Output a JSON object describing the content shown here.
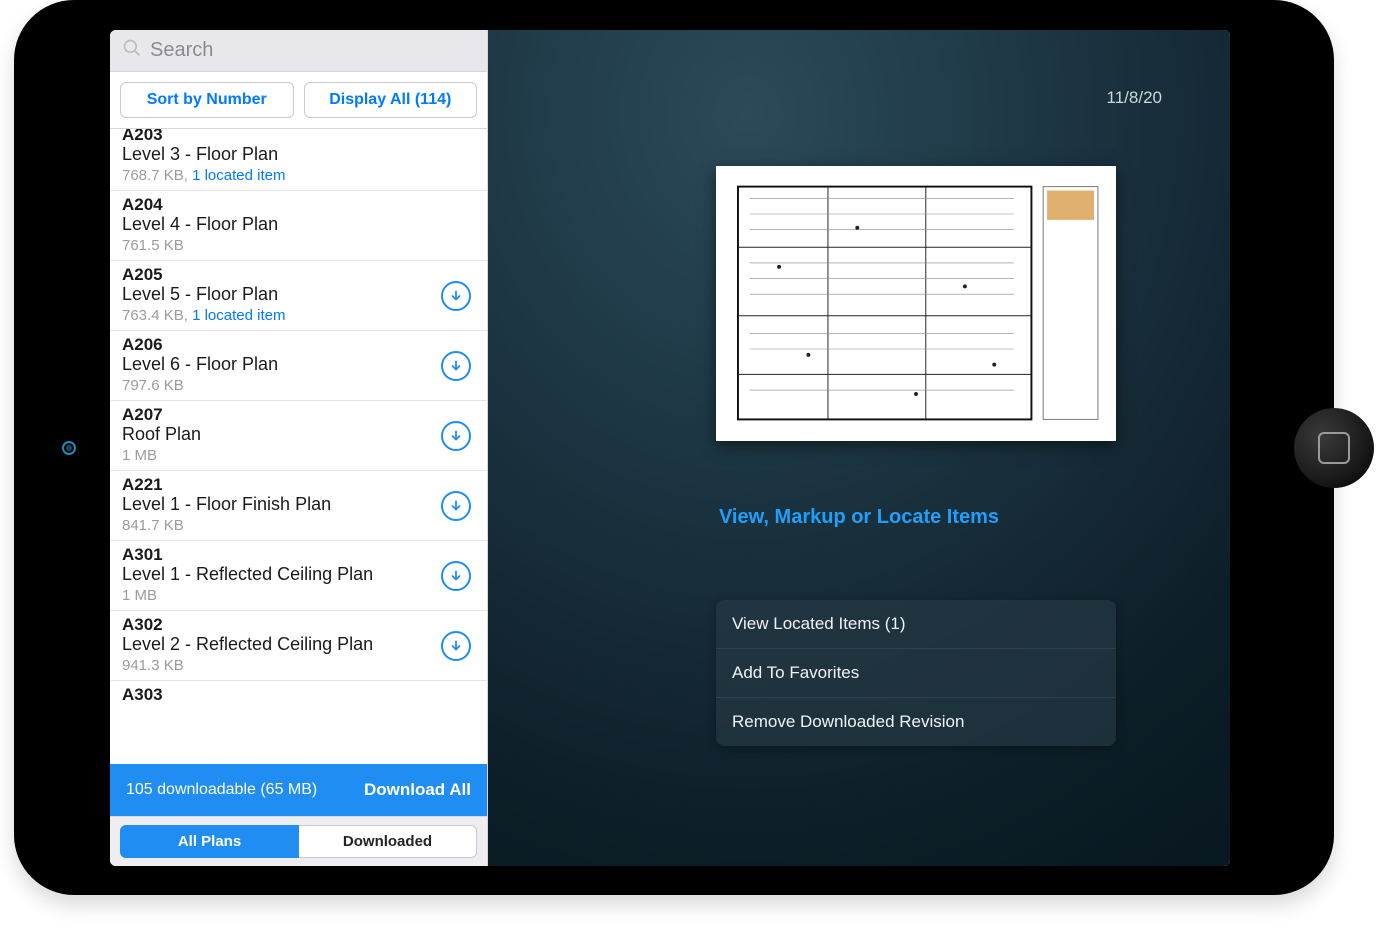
{
  "search": {
    "placeholder": "Search"
  },
  "toolbar": {
    "sort_label": "Sort by Number",
    "display_label": "Display All (114)"
  },
  "plans": [
    {
      "num": "A203",
      "title": "Level 3 - Floor Plan",
      "size": "768.7 KB",
      "located": "1 located item",
      "downloadable": false
    },
    {
      "num": "A204",
      "title": "Level 4 - Floor Plan",
      "size": "761.5 KB",
      "located": null,
      "downloadable": false
    },
    {
      "num": "A205",
      "title": "Level 5 - Floor Plan",
      "size": "763.4 KB",
      "located": "1 located item",
      "downloadable": true
    },
    {
      "num": "A206",
      "title": "Level 6 - Floor Plan",
      "size": "797.6 KB",
      "located": null,
      "downloadable": true
    },
    {
      "num": "A207",
      "title": "Roof Plan",
      "size": "1 MB",
      "located": null,
      "downloadable": true
    },
    {
      "num": "A221",
      "title": "Level 1 - Floor Finish Plan",
      "size": "841.7 KB",
      "located": null,
      "downloadable": true
    },
    {
      "num": "A301",
      "title": "Level 1 - Reflected Ceiling Plan",
      "size": "1 MB",
      "located": null,
      "downloadable": true
    },
    {
      "num": "A302",
      "title": "Level 2 - Reflected Ceiling Plan",
      "size": "941.3 KB",
      "located": null,
      "downloadable": true
    },
    {
      "num": "A303",
      "title": "",
      "size": "",
      "located": null,
      "downloadable": false
    }
  ],
  "download_bar": {
    "summary": "105 downloadable (65 MB)",
    "action": "Download All"
  },
  "segments": {
    "all": "All Plans",
    "downloaded": "Downloaded"
  },
  "detail": {
    "date": "11/8/20",
    "cta": "View, Markup or Locate Items",
    "actions": {
      "view_located": "View Located Items (1)",
      "add_favorite": "Add To Favorites",
      "remove_downloaded": "Remove Downloaded Revision"
    }
  }
}
